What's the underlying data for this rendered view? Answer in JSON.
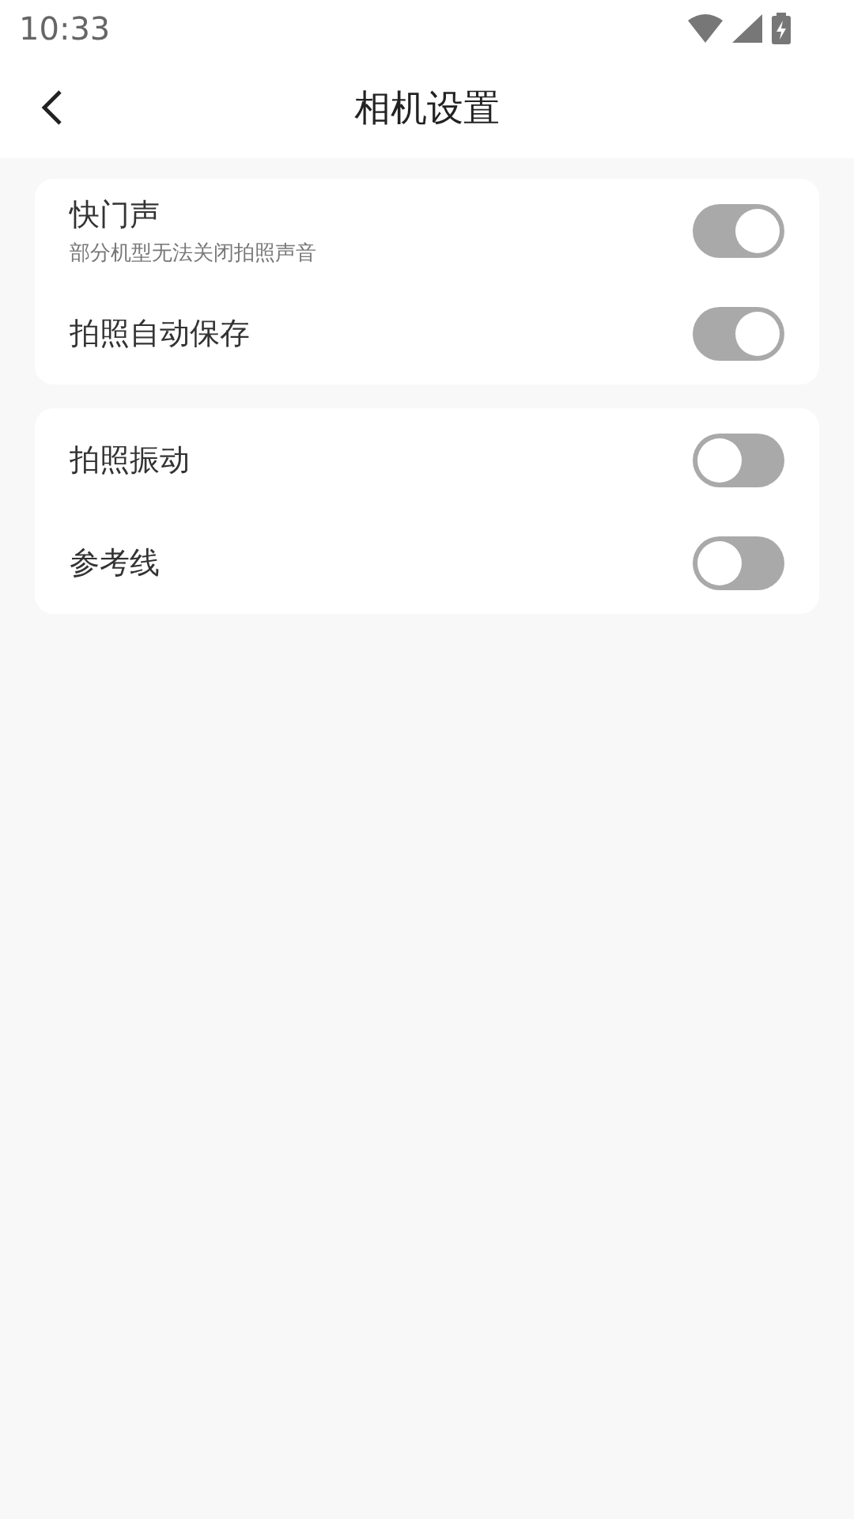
{
  "status_bar": {
    "time": "10:33"
  },
  "header": {
    "title": "相机设置"
  },
  "groups": [
    {
      "items": [
        {
          "label": "快门声",
          "description": "部分机型无法关闭拍照声音",
          "on": true
        },
        {
          "label": "拍照自动保存",
          "on": true
        }
      ]
    },
    {
      "items": [
        {
          "label": "拍照振动",
          "on": false
        },
        {
          "label": "参考线",
          "on": false
        }
      ]
    }
  ]
}
